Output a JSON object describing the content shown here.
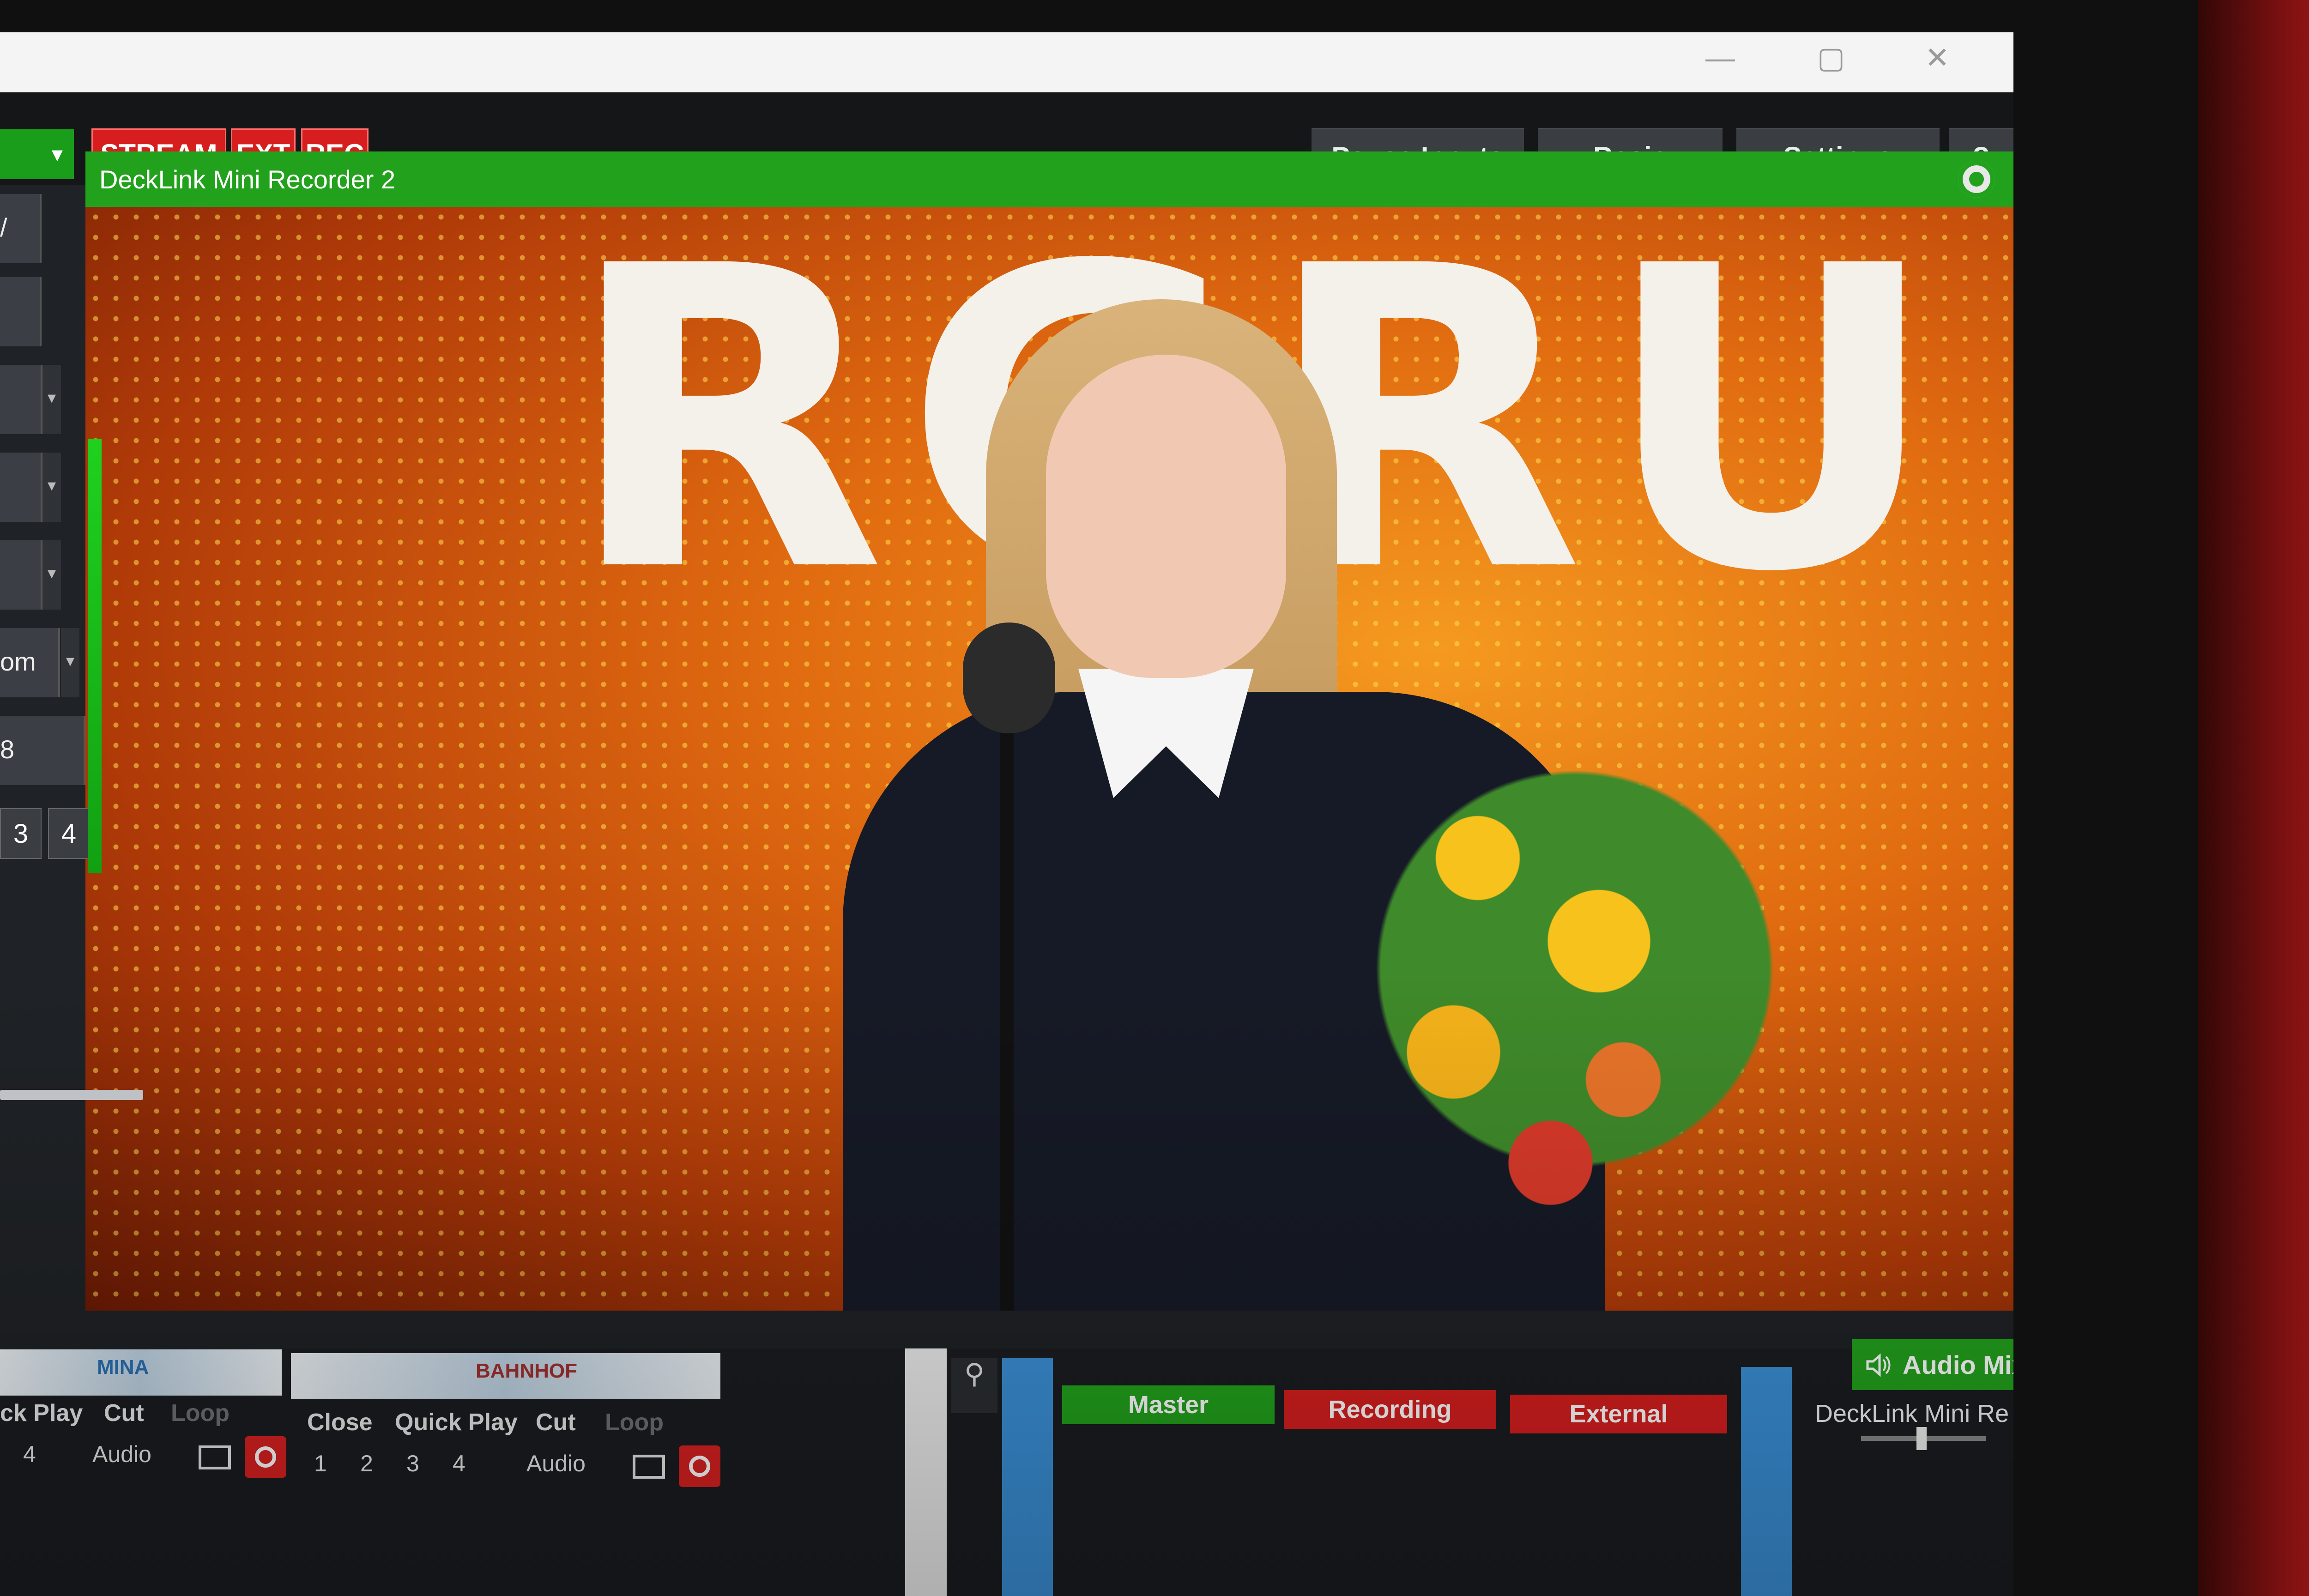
{
  "toolbar": {
    "stream_label": "STREAM",
    "ext_label": "EXT",
    "rec_label": "REC",
    "pause_inputs_label": "Pause Inputs",
    "basic_label": "Basic",
    "settings_label": "Settings",
    "help_label": "?",
    "dropdown_arrow": "▾"
  },
  "window": {
    "minimize": "—",
    "maximize": "▢",
    "close": "✕"
  },
  "preview": {
    "title": "DeckLink Mini Recorder 2",
    "video_text": "RGRU"
  },
  "left_panel": {
    "item_1": "/",
    "item_2": "",
    "item_partial_1": "om",
    "item_partial_2": "8",
    "overlay_buttons": [
      "3",
      "4"
    ]
  },
  "inputs": [
    {
      "thumbnail_text": "MINA",
      "controls": [
        "ck Play",
        "Cut",
        "Loop"
      ],
      "row2": [
        "4",
        "Audio"
      ]
    },
    {
      "thumbnail_text": "BAHNHOF",
      "controls": [
        "Close",
        "Quick Play",
        "Cut",
        "Loop"
      ],
      "row2": [
        "1",
        "2",
        "3",
        "4",
        "Audio"
      ]
    }
  ],
  "output_tabs": {
    "master": "Master",
    "recording": "Recording",
    "external": "External"
  },
  "audio_mixer": {
    "title": "Audio Mixer",
    "channel_label": "DeckLink Mini Re"
  },
  "colors": {
    "accent_green": "#22a11c",
    "record_red": "#d61e1e",
    "button_gray": "#3a3d42"
  }
}
